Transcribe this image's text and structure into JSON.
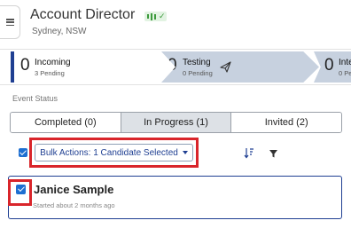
{
  "header": {
    "title": "Account Director",
    "location": "Sydney, NSW",
    "status_badge_check": "✓",
    "badge_color": "#3c9a3c"
  },
  "stages": [
    {
      "count": "0",
      "name": "Incoming",
      "pending": "3 Pending"
    },
    {
      "count": "0",
      "name": "Testing",
      "pending": "0 Pending",
      "icon": "paper-plane-icon"
    },
    {
      "count": "0",
      "name": "Inte",
      "pending": "0 Pen"
    }
  ],
  "event_status": {
    "label": "Event Status",
    "tabs": [
      {
        "label": "Completed (0)",
        "active": false
      },
      {
        "label": "In Progress (1)",
        "active": true
      },
      {
        "label": "Invited (2)",
        "active": false
      }
    ]
  },
  "toolbar": {
    "select_all_checked": true,
    "bulk_actions_label": "Bulk Actions: 1 Candidate Selected",
    "icons": [
      "sort-icon",
      "filter-icon"
    ]
  },
  "candidates": [
    {
      "name": "Janice Sample",
      "started": "Started about 2 months ago",
      "checked": true
    }
  ],
  "colors": {
    "primary": "#1f3f92",
    "checkbox": "#1e6fd1",
    "highlight": "#d9252b",
    "stage_fill": "#c7d1df"
  }
}
